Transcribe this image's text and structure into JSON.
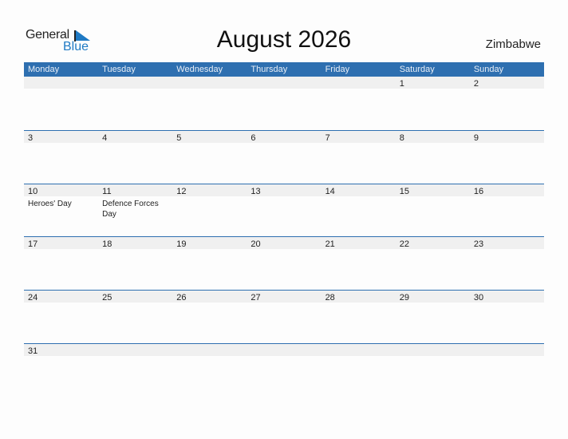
{
  "logo": {
    "general": "General",
    "blue": "Blue",
    "icon": "triangle-flag-icon"
  },
  "title": "August 2026",
  "country": "Zimbabwe",
  "colors": {
    "header": "#2e6fb0",
    "strip": "#f0f0f0",
    "brand_blue": "#1f7ac4"
  },
  "weekdays": [
    "Monday",
    "Tuesday",
    "Wednesday",
    "Thursday",
    "Friday",
    "Saturday",
    "Sunday"
  ],
  "weeks": [
    {
      "days": [
        {
          "n": "",
          "h": ""
        },
        {
          "n": "",
          "h": ""
        },
        {
          "n": "",
          "h": ""
        },
        {
          "n": "",
          "h": ""
        },
        {
          "n": "",
          "h": ""
        },
        {
          "n": "1",
          "h": ""
        },
        {
          "n": "2",
          "h": ""
        }
      ]
    },
    {
      "days": [
        {
          "n": "3",
          "h": ""
        },
        {
          "n": "4",
          "h": ""
        },
        {
          "n": "5",
          "h": ""
        },
        {
          "n": "6",
          "h": ""
        },
        {
          "n": "7",
          "h": ""
        },
        {
          "n": "8",
          "h": ""
        },
        {
          "n": "9",
          "h": ""
        }
      ]
    },
    {
      "days": [
        {
          "n": "10",
          "h": "Heroes' Day"
        },
        {
          "n": "11",
          "h": "Defence Forces Day"
        },
        {
          "n": "12",
          "h": ""
        },
        {
          "n": "13",
          "h": ""
        },
        {
          "n": "14",
          "h": ""
        },
        {
          "n": "15",
          "h": ""
        },
        {
          "n": "16",
          "h": ""
        }
      ]
    },
    {
      "days": [
        {
          "n": "17",
          "h": ""
        },
        {
          "n": "18",
          "h": ""
        },
        {
          "n": "19",
          "h": ""
        },
        {
          "n": "20",
          "h": ""
        },
        {
          "n": "21",
          "h": ""
        },
        {
          "n": "22",
          "h": ""
        },
        {
          "n": "23",
          "h": ""
        }
      ]
    },
    {
      "days": [
        {
          "n": "24",
          "h": ""
        },
        {
          "n": "25",
          "h": ""
        },
        {
          "n": "26",
          "h": ""
        },
        {
          "n": "27",
          "h": ""
        },
        {
          "n": "28",
          "h": ""
        },
        {
          "n": "29",
          "h": ""
        },
        {
          "n": "30",
          "h": ""
        }
      ]
    },
    {
      "days": [
        {
          "n": "31",
          "h": ""
        },
        {
          "n": "",
          "h": ""
        },
        {
          "n": "",
          "h": ""
        },
        {
          "n": "",
          "h": ""
        },
        {
          "n": "",
          "h": ""
        },
        {
          "n": "",
          "h": ""
        },
        {
          "n": "",
          "h": ""
        }
      ]
    }
  ]
}
